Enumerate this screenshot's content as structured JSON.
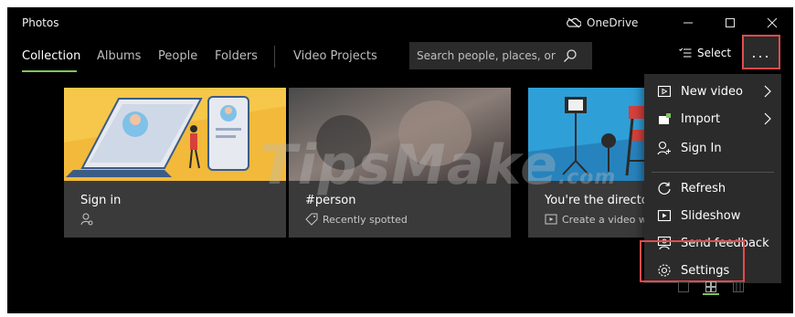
{
  "window": {
    "app_title": "Photos",
    "onedrive_label": "OneDrive"
  },
  "nav": {
    "tabs": [
      {
        "label": "Collection",
        "active": true
      },
      {
        "label": "Albums",
        "active": false
      },
      {
        "label": "People",
        "active": false
      },
      {
        "label": "Folders",
        "active": false
      },
      {
        "label": "Video Projects",
        "active": false
      }
    ],
    "search_placeholder": "Search people, places, or",
    "select_label": "Select",
    "more_label": "..."
  },
  "cards": [
    {
      "title": "Sign in",
      "subtitle": "",
      "icon": "person-icon"
    },
    {
      "title": "#person",
      "subtitle": "Recently spotted",
      "icon": "tag-icon"
    },
    {
      "title": "You're the director",
      "subtitle": "Create a video wi",
      "icon": "video-icon"
    }
  ],
  "menu": {
    "items": [
      {
        "label": "New video",
        "icon": "new-video-icon",
        "submenu": true
      },
      {
        "label": "Import",
        "icon": "import-icon",
        "submenu": true
      },
      {
        "label": "Sign In",
        "icon": "sign-in-icon",
        "submenu": false
      },
      {
        "label": "Refresh",
        "icon": "refresh-icon",
        "submenu": false
      },
      {
        "label": "Slideshow",
        "icon": "slideshow-icon",
        "submenu": false
      },
      {
        "label": "Send feedback",
        "icon": "feedback-icon",
        "submenu": false
      },
      {
        "label": "Settings",
        "icon": "settings-icon",
        "submenu": false
      }
    ]
  },
  "watermark": {
    "text": "TipsMake",
    "suffix": ".com"
  },
  "colors": {
    "accent_green": "#7ec65b",
    "highlight_red": "#e44c4c",
    "background": "#000000",
    "menu_bg": "#2b2b2b",
    "card_bg": "#3a3a3a"
  }
}
